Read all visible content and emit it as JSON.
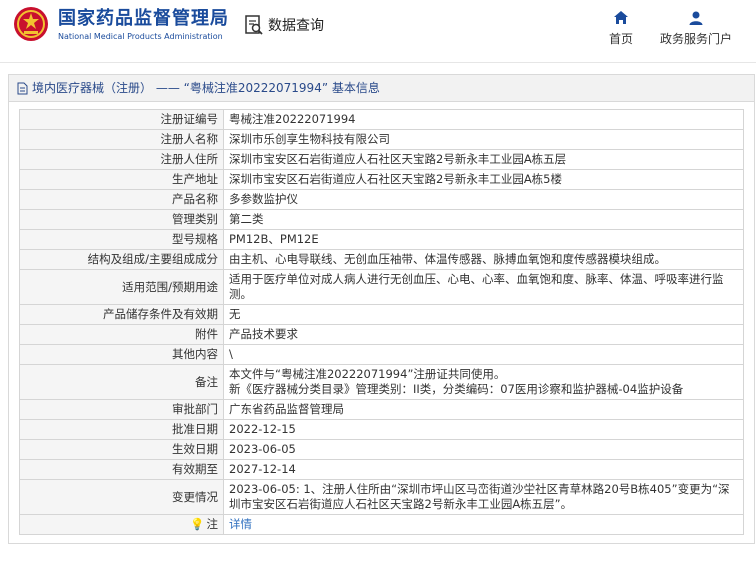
{
  "header": {
    "org_cn": "国家药品监督管理局",
    "org_en": "National Medical Products Administration",
    "search_label": "数据查询",
    "nav": [
      {
        "label": "首页",
        "icon": "home-icon"
      },
      {
        "label": "政务服务门户",
        "icon": "user-icon"
      }
    ]
  },
  "section": {
    "title": "境内医疗器械（注册） —— “粤械注准20222071994” 基本信息"
  },
  "rows": [
    {
      "label": "注册证编号",
      "value": "粤械注准20222071994"
    },
    {
      "label": "注册人名称",
      "value": "深圳市乐创享生物科技有限公司"
    },
    {
      "label": "注册人住所",
      "value": "深圳市宝安区石岩街道应人石社区天宝路2号新永丰工业园A栋五层"
    },
    {
      "label": "生产地址",
      "value": "深圳市宝安区石岩街道应人石社区天宝路2号新永丰工业园A栋5楼"
    },
    {
      "label": "产品名称",
      "value": "多参数监护仪"
    },
    {
      "label": "管理类别",
      "value": "第二类"
    },
    {
      "label": "型号规格",
      "value": "PM12B、PM12E"
    },
    {
      "label": "结构及组成/主要组成成分",
      "value": "由主机、心电导联线、无创血压袖带、体温传感器、脉搏血氧饱和度传感器模块组成。"
    },
    {
      "label": "适用范围/预期用途",
      "value": "适用于医疗单位对成人病人进行无创血压、心电、心率、血氧饱和度、脉率、体温、呼吸率进行监测。"
    },
    {
      "label": "产品储存条件及有效期",
      "value": "无"
    },
    {
      "label": "附件",
      "value": "产品技术要求"
    },
    {
      "label": "其他内容",
      "value": "\\"
    },
    {
      "label": "备注",
      "lines": [
        "本文件与“粤械注准20222071994”注册证共同使用。",
        "新《医疗器械分类目录》管理类别：II类，分类编码：07医用诊察和监护器械-04监护设备"
      ]
    },
    {
      "label": "审批部门",
      "value": "广东省药品监督管理局"
    },
    {
      "label": "批准日期",
      "value": "2022-12-15"
    },
    {
      "label": "生效日期",
      "value": "2023-06-05"
    },
    {
      "label": "有效期至",
      "value": "2027-12-14"
    },
    {
      "label": "变更情况",
      "value": "2023-06-05: 1、注册人住所由“深圳市坪山区马峦街道沙坣社区青草林路20号B栋405”变更为“深圳市宝安区石岩街道应人石社区天宝路2号新永丰工业园A栋五层”。"
    }
  ],
  "footer_row": {
    "label": "注",
    "link": "详情"
  }
}
